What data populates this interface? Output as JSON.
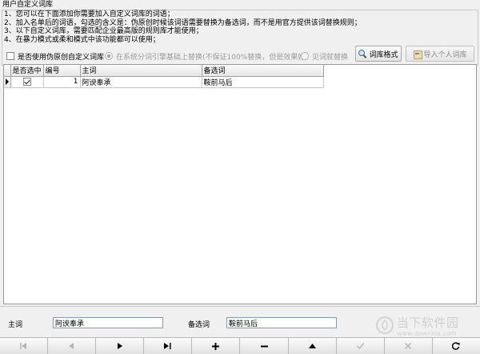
{
  "window": {
    "title": "用户自定义词库"
  },
  "instructions": [
    "1、您可以在下面添加你需要加入自定义词库的词语；",
    "2、加入名单后的词语，勾选的含义是：伪原创时候该词语需要替换为备选词，而不是用官方提供该词替换规则；",
    "3、以下自定义词库，需要匹配企业最高版的规则库才能使用；",
    "4、在暴力模式或柔和模式中该功能都可以使用；"
  ],
  "options": {
    "use_custom_label": "是否使用伪原创自定义词库",
    "use_custom_checked": false,
    "system_replace_label": "在系统分词引擎基础上替换(不保证100%替换，但是效果好)",
    "system_replace_checked": true,
    "see_replace_label": "见词就替换",
    "see_replace_checked": false
  },
  "toolbar": {
    "format_label": "词库格式",
    "import_label": "导入个人词库"
  },
  "grid": {
    "columns": [
      "是否选中",
      "编号",
      "主词",
      "备选词"
    ],
    "rows": [
      {
        "selected": true,
        "id": "1",
        "main": "阿谀奉承",
        "alt": "鞍前马后"
      }
    ]
  },
  "form": {
    "main_label": "主词",
    "main_value": "阿谀奉承",
    "alt_label": "备选词",
    "alt_value": "鞍前马后"
  },
  "watermark": {
    "text": "当下软件园",
    "sub": "www.downxia.com"
  },
  "colors": {
    "input_border": "#7f9db9",
    "disabled_text": "#9a9a9a"
  }
}
